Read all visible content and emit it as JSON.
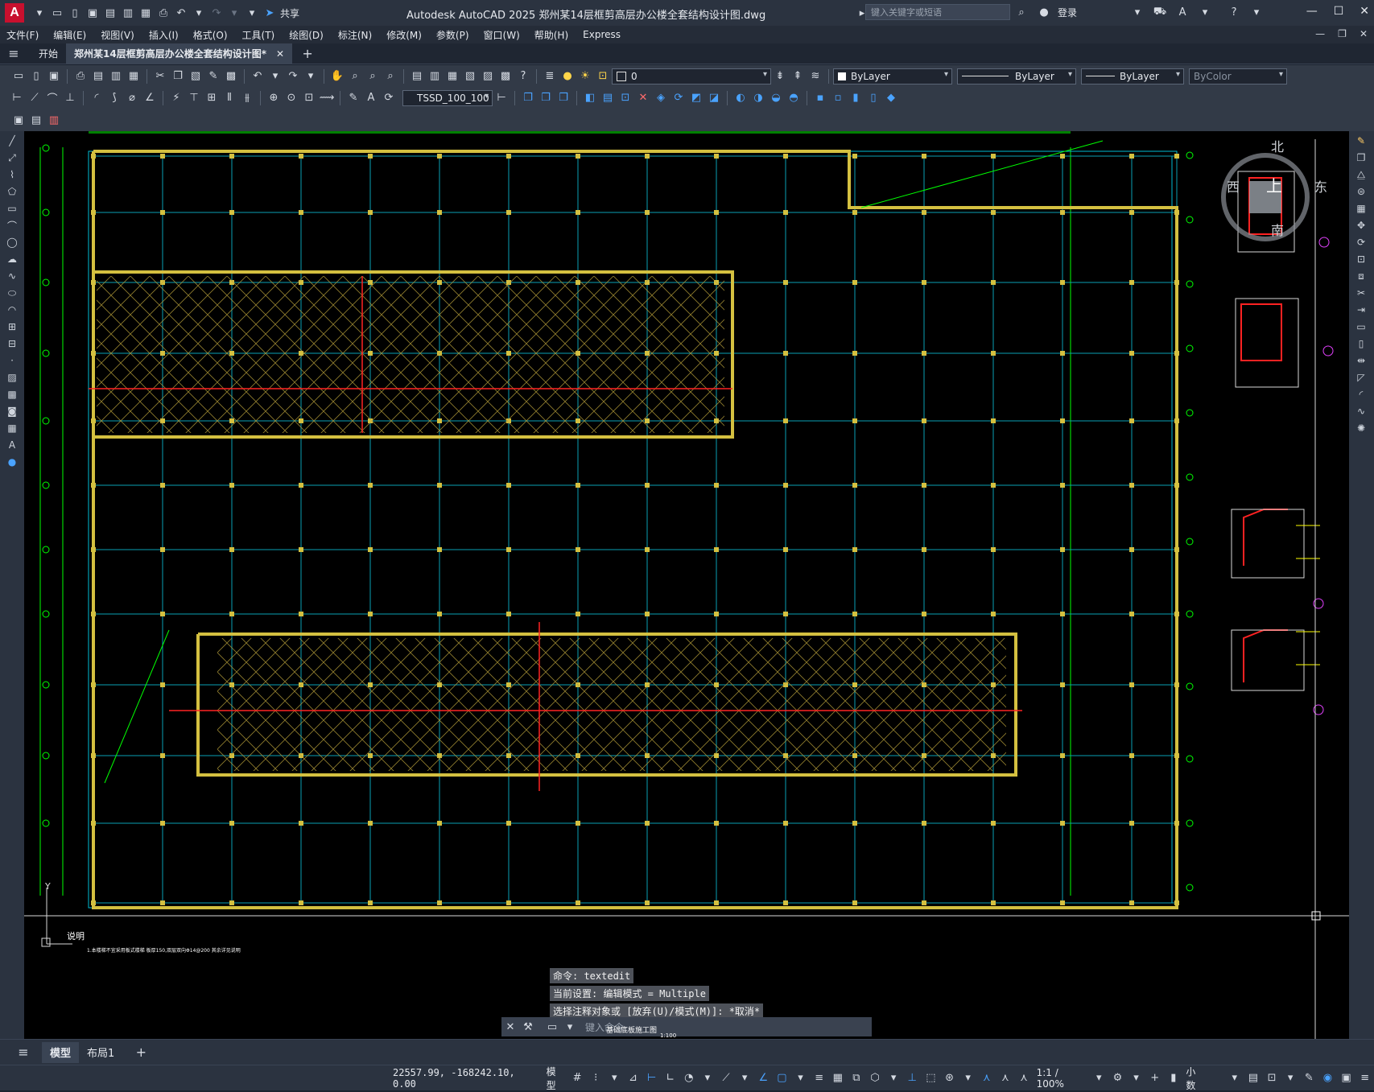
{
  "app": {
    "title": "Autodesk AutoCAD 2025    郑州某14层框剪高层办公楼全套结构设计图.dwg",
    "share_label": "共享",
    "search_placeholder": "键入关键字或短语",
    "login_label": "登录"
  },
  "menu": [
    "文件(F)",
    "编辑(E)",
    "视图(V)",
    "插入(I)",
    "格式(O)",
    "工具(T)",
    "绘图(D)",
    "标注(N)",
    "修改(M)",
    "参数(P)",
    "窗口(W)",
    "帮助(H)",
    "Express"
  ],
  "doctabs": {
    "start": "开始",
    "active": "郑州某14层框剪高层办公楼全套结构设计图*"
  },
  "toolbar": {
    "layer_value": "0",
    "color_value": "ByLayer",
    "linetype_value": "ByLayer",
    "lineweight_value": "ByLayer",
    "plotstyle_value": "ByColor",
    "dimstyle_value": "TSSD_100_100"
  },
  "viewcube": {
    "north": "北",
    "south": "南",
    "east": "东",
    "west": "西",
    "top": "上"
  },
  "command": {
    "line1": "命令: textedit",
    "line2": "当前设置: 编辑模式 = Multiple",
    "line3": "选择注释对象或 [放弃(U)/模式(M)]: *取消*",
    "placeholder": "键入命令"
  },
  "drawing": {
    "note_title": "说明",
    "ucs_y": "Y",
    "note_text": "1.本楼梯不宜采用板式楼梯 板厚150,双层双向Φ14@200 其余详见说明",
    "plan_label": "基础底板施工图",
    "scale_label": "1:100"
  },
  "layouts": [
    "模型",
    "布局1"
  ],
  "status": {
    "coords": "22557.99, -168242.10, 0.00",
    "model_label": "模型",
    "scale": "1:1 / 100%",
    "units": "小数"
  }
}
